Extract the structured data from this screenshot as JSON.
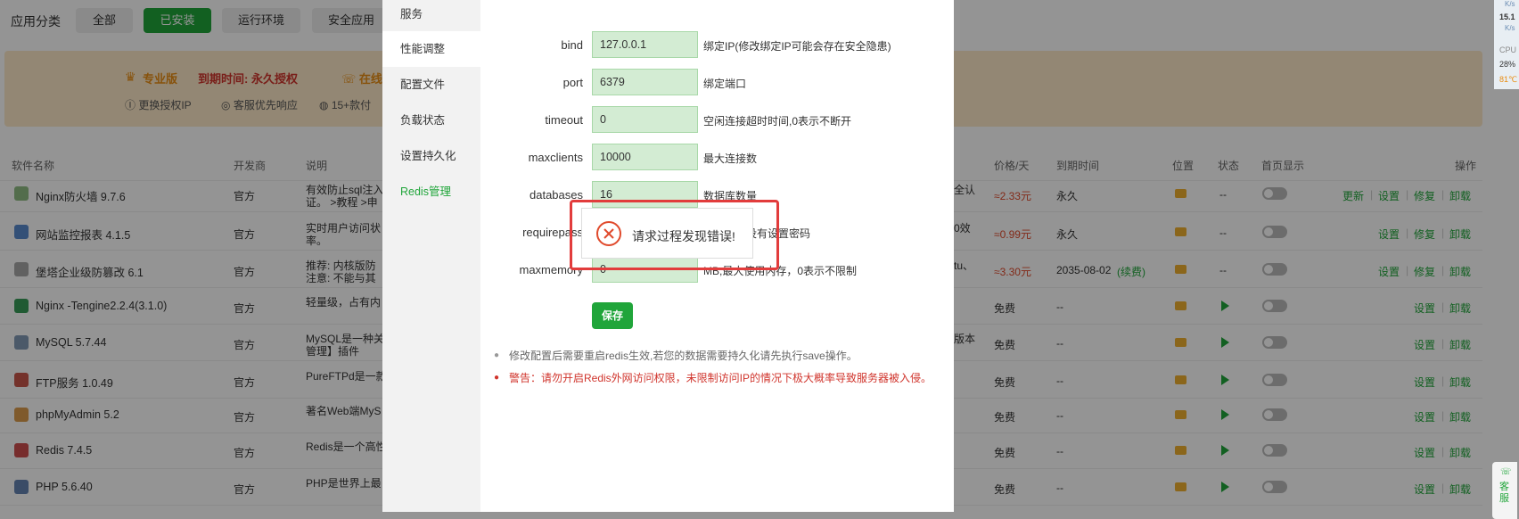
{
  "top": {
    "label": "应用分类",
    "tabs": [
      "全部",
      "已安装",
      "运行环境",
      "安全应用"
    ]
  },
  "promo": {
    "edition": "专业版",
    "expire": "到期时间: 永久授权",
    "online": "在线",
    "perks": [
      "更换授权IP",
      "客服优先响应",
      "15+款付"
    ]
  },
  "table": {
    "headers": {
      "name": "软件名称",
      "dev": "开发商",
      "desc": "说明",
      "price": "价格/天",
      "expire": "到期时间",
      "location": "位置",
      "status": "状态",
      "homepage": "首页显示",
      "ops": "操作"
    },
    "rows": [
      {
        "name": "Nginx防火墙 9.7.6",
        "dev": "官方",
        "desc1": "有效防止sql注入",
        "desc2": "证。 >教程 >申",
        "extra": "全认",
        "price": "≈2.33元",
        "expire": "永久",
        "status": "--",
        "ops": [
          "更新",
          "设置",
          "修复",
          "卸载"
        ]
      },
      {
        "name": "网站监控报表 4.1.5",
        "dev": "官方",
        "desc1": "实时用户访问状",
        "desc2": "率。",
        "extra": "0效",
        "price": "≈0.99元",
        "expire": "永久",
        "status": "--",
        "ops": [
          "设置",
          "修复",
          "卸载"
        ]
      },
      {
        "name": "堡塔企业级防篡改 6.1",
        "dev": "官方",
        "desc1": "推荐: 内核版防",
        "desc2": "注意: 不能与其",
        "extra": "tu、",
        "price": "≈3.30元",
        "expire": "2035-08-02",
        "renew": "(续费)",
        "status": "--",
        "ops": [
          "设置",
          "修复",
          "卸载"
        ]
      },
      {
        "name": "Nginx -Tengine2.2.4(3.1.0)",
        "dev": "官方",
        "desc1": "轻量级，占有内",
        "desc2": "",
        "extra": "",
        "price": "免费",
        "expire": "--",
        "status": "",
        "ops": [
          "设置",
          "卸载"
        ]
      },
      {
        "name": "MySQL 5.7.44",
        "dev": "官方",
        "desc1": "MySQL是一种关",
        "desc2": "管理】插件",
        "extra": "版本",
        "price": "免费",
        "expire": "--",
        "status": "",
        "ops": [
          "设置",
          "卸载"
        ]
      },
      {
        "name": "FTP服务 1.0.49",
        "dev": "官方",
        "desc1": "PureFTPd是一款",
        "desc2": "",
        "extra": "",
        "price": "免费",
        "expire": "--",
        "status": "",
        "ops": [
          "设置",
          "卸载"
        ]
      },
      {
        "name": "phpMyAdmin 5.2",
        "dev": "官方",
        "desc1": "著名Web端MyS",
        "desc2": "",
        "extra": "",
        "price": "免费",
        "expire": "--",
        "status": "",
        "ops": [
          "设置",
          "卸载"
        ]
      },
      {
        "name": "Redis 7.4.5",
        "dev": "官方",
        "desc1": "Redis是一个高性",
        "desc2": "",
        "extra": "",
        "price": "免费",
        "expire": "--",
        "status": "",
        "ops": [
          "设置",
          "卸载"
        ]
      },
      {
        "name": "PHP 5.6.40",
        "dev": "官方",
        "desc1": "PHP是世界上最",
        "desc2": "",
        "extra": "",
        "price": "免费",
        "expire": "--",
        "status": "",
        "ops": [
          "设置",
          "卸载"
        ]
      }
    ]
  },
  "modal": {
    "nav": [
      "服务",
      "性能调整",
      "配置文件",
      "负载状态",
      "设置持久化",
      "Redis管理"
    ],
    "fields": [
      {
        "label": "bind",
        "value": "127.0.0.1",
        "hint": "绑定IP(修改绑定IP可能会存在安全隐患)"
      },
      {
        "label": "port",
        "value": "6379",
        "hint": "绑定端口"
      },
      {
        "label": "timeout",
        "value": "0",
        "hint": "空闲连接超时时间,0表示不断开"
      },
      {
        "label": "maxclients",
        "value": "10000",
        "hint": "最大连接数"
      },
      {
        "label": "databases",
        "value": "16",
        "hint": "数据库数量"
      },
      {
        "label": "requirepass",
        "value": "",
        "hint": "留空代表没有设置密码"
      },
      {
        "label": "maxmemory",
        "value": "0",
        "hint": "MB,最大使用内存，0表示不限制"
      }
    ],
    "save": "保存",
    "note1": "修改配置后需要重启redis生效,若您的数据需要持久化请先执行save操作。",
    "note2": "警告：请勿开启Redis外网访问权限，未限制访问IP的情况下极大概率导致服务器被入侵。"
  },
  "dialog": {
    "message": "请求过程发现错误!"
  },
  "rightbar": {
    "net1": "K/s",
    "net1v": "15.1",
    "net2": "K/s",
    "cpu": "CPU",
    "cpuv": "28%",
    "temp": "81℃",
    "kefu": "客服"
  }
}
